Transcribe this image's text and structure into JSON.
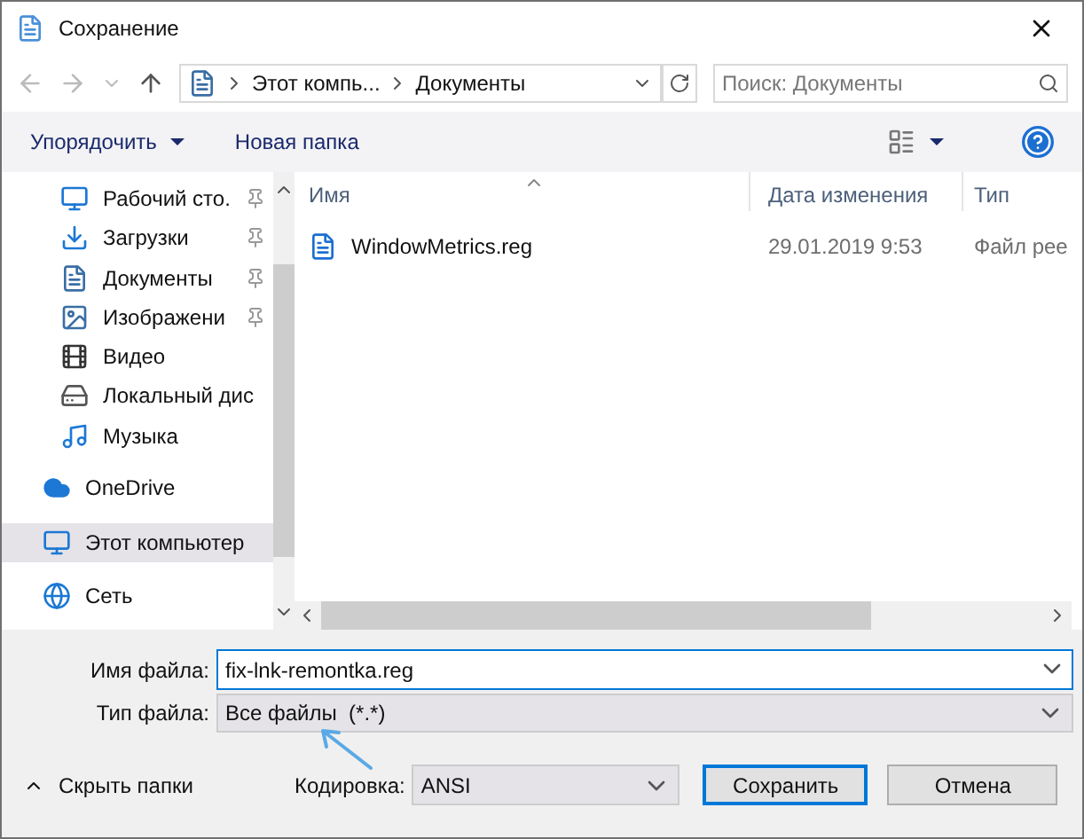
{
  "window": {
    "title": "Сохранение"
  },
  "address": {
    "segments": [
      "Этот компь...",
      "Документы"
    ]
  },
  "search": {
    "placeholder": "Поиск: Документы"
  },
  "toolbar": {
    "organize": "Упорядочить",
    "new_folder": "Новая папка"
  },
  "sidebar": {
    "quick_access": [
      {
        "label": "Рабочий сто.",
        "pinned": true
      },
      {
        "label": "Загрузки",
        "pinned": true
      },
      {
        "label": "Документы",
        "pinned": true
      },
      {
        "label": "Изображени",
        "pinned": true
      },
      {
        "label": "Видео",
        "pinned": false
      },
      {
        "label": "Локальный дис",
        "pinned": false
      },
      {
        "label": "Музыка",
        "pinned": false
      }
    ],
    "locations": [
      {
        "label": "OneDrive",
        "selected": false
      },
      {
        "label": "Этот компьютер",
        "selected": true
      },
      {
        "label": "Сеть",
        "selected": false
      }
    ]
  },
  "table": {
    "columns": [
      "Имя",
      "Дата изменения",
      "Тип"
    ],
    "rows": [
      {
        "name": "WindowMetrics.reg",
        "date": "29.01.2019 9:53",
        "type": "Файл рее"
      }
    ]
  },
  "form": {
    "file_name": {
      "label": "Имя файла:",
      "value": "fix-lnk-remontka.reg"
    },
    "file_type": {
      "label": "Тип файла:",
      "value": "Все файлы  (*.*)"
    },
    "encoding": {
      "label": "Кодировка:",
      "value": "ANSI"
    }
  },
  "hide_folders": "Скрыть папки",
  "buttons": [
    "Сохранить",
    "Отмена"
  ]
}
